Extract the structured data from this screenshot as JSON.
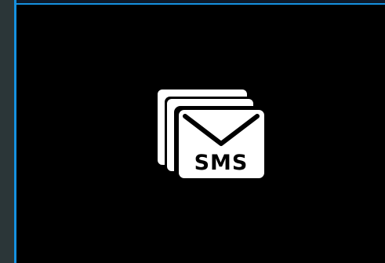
{
  "window": {
    "left_bar_color": "#2b3638",
    "accent_color": "#1591e0",
    "background_color": "#000000"
  },
  "center_icon": {
    "icon": "sms-messages-icon",
    "label": "SMS",
    "foreground_color": "#ffffff"
  }
}
